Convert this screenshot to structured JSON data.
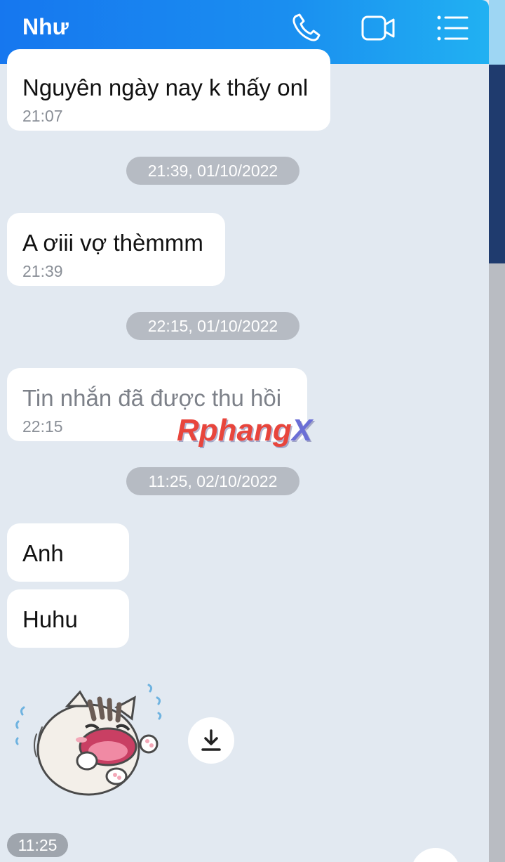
{
  "header": {
    "contact_name": "Như",
    "icons": [
      "phone-icon",
      "video-call-icon",
      "menu-list-icon"
    ]
  },
  "messages": [
    {
      "text": "Nguyên ngày nay k thấy onl",
      "time": "21:07"
    },
    {
      "text": "A ơiii vợ thèmmm",
      "time": "21:39"
    },
    {
      "text": "Tin nhắn đã được thu hồi",
      "time": "22:15",
      "recalled": true
    },
    {
      "text": "Anh"
    },
    {
      "text": "Huhu"
    }
  ],
  "date_separators": [
    "21:39, 01/10/2022",
    "22:15, 01/10/2022",
    "11:25, 02/10/2022"
  ],
  "watermark": {
    "main": "Rphang",
    "accent": "X"
  },
  "sticker": {
    "icon": "crying-cat-sticker",
    "download_icon": "download-icon"
  },
  "last_time": "11:25",
  "colors": {
    "header_start": "#1677ef",
    "header_end": "#21b1f2",
    "chat_background": "#e2e9f1",
    "bubble": "#ffffff"
  }
}
